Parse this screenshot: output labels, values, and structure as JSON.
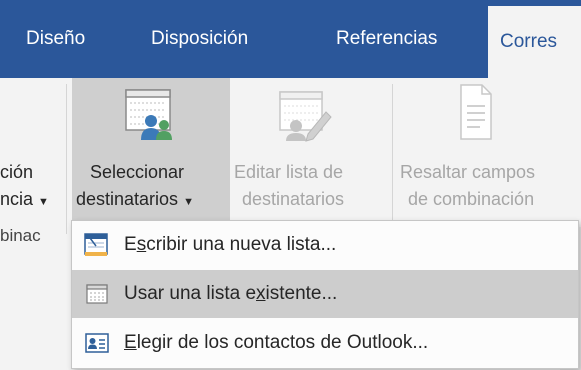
{
  "tabs": [
    {
      "label": "Diseño"
    },
    {
      "label": "Disposición"
    },
    {
      "label": "Referencias"
    },
    {
      "label": "Corres"
    }
  ],
  "ribbon": {
    "left_cut": {
      "line1": "ción",
      "line2": "ncia",
      "group_label": "binac"
    },
    "select_recipients": {
      "line1": "Seleccionar",
      "line2": "destinatarios"
    },
    "edit_list": {
      "line1": "Editar lista de",
      "line2": "destinatarios"
    },
    "highlight_fields": {
      "line1": "Resaltar campos",
      "line2": "de combinación"
    }
  },
  "menu": {
    "items": [
      {
        "pre": "E",
        "accel": "s",
        "post": "cribir una nueva lista...",
        "icon": "new-list-icon"
      },
      {
        "pre": "Usar una lista e",
        "accel": "x",
        "post": "istente...",
        "icon": "table-icon"
      },
      {
        "pre": "",
        "accel": "E",
        "post": "legir de los contactos de Outlook...",
        "icon": "contact-card-icon"
      }
    ]
  },
  "colors": {
    "tabbar": "#2b579a",
    "ribbon": "#f3f3f3",
    "selected_button": "#cfcfcf",
    "hover_item": "#cdcdcd"
  }
}
